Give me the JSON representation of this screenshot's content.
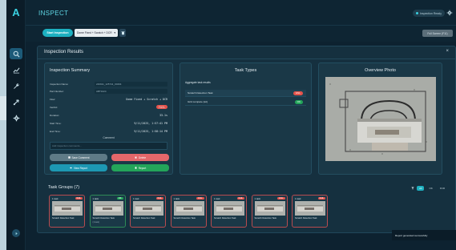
{
  "app": {
    "title": "INSPECT",
    "help_label": "Inspection Ready"
  },
  "toolbar": {
    "start_label": "Start Inspection",
    "select_value": "Dome Fixed + Scratch + DCR",
    "fullscreen_label": "Full Screen (F11)"
  },
  "modal": {
    "title": "Inspection Results",
    "close": "×",
    "summary": {
      "title": "Inspection Summary",
      "rows": [
        {
          "key": "Inspection Name:",
          "value": "240911_125741_00294"
        },
        {
          "key": "Part Number:",
          "value": "ABT1024"
        },
        {
          "key": "Flow:",
          "value": "Dome Fixed + Scratch + DCR"
        },
        {
          "key": "Verdict:",
          "value": "FAIL"
        },
        {
          "key": "Duration:",
          "value": "33.1s"
        },
        {
          "key": "Start Time:",
          "value": "9/11/2025, 1:57:41 PM"
        },
        {
          "key": "End Time:",
          "value": "9/11/2025, 1:58:14 PM"
        }
      ],
      "comments_label": "Comment",
      "comments_placeholder": "Add inspection comments...",
      "actions": {
        "save_comment": "Save Comment",
        "delete": "Delete",
        "view_report": "View Report",
        "report": "Report"
      }
    },
    "task_types": {
      "title": "Task Types",
      "header": "Aggregate task results",
      "rows": [
        {
          "label": "Scratch Detection Task",
          "status": "FAIL",
          "status_color": "#e5534b"
        },
        {
          "label": "Grid compare (tol)",
          "status": "OK",
          "status_color": "#23a55a"
        }
      ]
    },
    "overview": {
      "title": "Overview Photo"
    },
    "task_groups": {
      "title": "Task Groups (7)",
      "filters": [
        "All",
        "OK",
        "FCR"
      ],
      "active_filter": "All",
      "cards": [
        {
          "count": "1 task",
          "status": "FAIL",
          "name": "Scratch Detection Task",
          "sub": ""
        },
        {
          "count": "1 task",
          "status": "OK",
          "name": "Scratch Detection Task",
          "sub": "(1 task)"
        },
        {
          "count": "1 task",
          "status": "FAIL",
          "name": "Scratch Detection Task",
          "sub": ""
        },
        {
          "count": "1 task",
          "status": "FAIL",
          "name": "Scratch Detection Task",
          "sub": ""
        },
        {
          "count": "1 task",
          "status": "FAIL",
          "name": "Scratch Detection Task",
          "sub": ""
        },
        {
          "count": "1 task",
          "status": "FAIL",
          "name": "Scratch Detection Task",
          "sub": ""
        },
        {
          "count": "1 task",
          "status": "FAIL",
          "name": "Scratch Detection Task",
          "sub": ""
        }
      ]
    }
  },
  "toast": {
    "message": "Report generated successfully"
  },
  "colors": {
    "accent": "#1db0c0",
    "fail": "#e5534b",
    "ok": "#23a55a",
    "navy": "#0d2230"
  }
}
